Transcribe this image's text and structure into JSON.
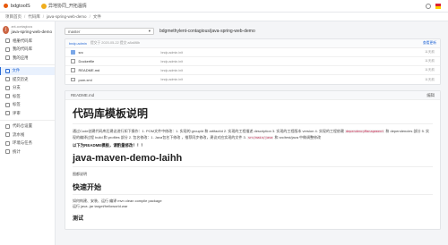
{
  "topbar": {
    "brand": "bdgtoolS",
    "user_switch": "异地协同_开拓温情"
  },
  "breadcrumb": [
    "项目首页",
    "代码库",
    "java-spring-web-demo",
    "文件"
  ],
  "sidebar": {
    "project_group": "ant-contagious",
    "project_name": "java-spring-web-demo",
    "project_initial": "j",
    "items": [
      {
        "label": "相册代码库",
        "active": false
      },
      {
        "label": "我的代码库",
        "active": false
      },
      {
        "label": "我的应用",
        "active": false
      },
      {
        "label": "文件",
        "active": true
      },
      {
        "label": "提交历史",
        "active": false
      },
      {
        "label": "分支",
        "active": false
      },
      {
        "label": "标签",
        "active": false
      },
      {
        "label": "标签",
        "active": false
      },
      {
        "label": "评审",
        "active": false
      },
      {
        "label": "代码仓设置",
        "active": false
      },
      {
        "label": "流水线",
        "active": false
      },
      {
        "label": "环境与任务",
        "active": false
      },
      {
        "label": "统计",
        "active": false
      }
    ]
  },
  "toolbar": {
    "branch": "master",
    "path": "bdgmethylent-contagious/java-spring-web-demo"
  },
  "commit": {
    "author": "bndp.admin",
    "text": "提交于 2020-05-22 提交 a8a6f8b",
    "count": "查看更新"
  },
  "files": [
    {
      "type": "folder",
      "name": "src",
      "msg": "bndp.admin.init",
      "time": "11天前"
    },
    {
      "type": "doc",
      "name": "Dockerfile",
      "msg": "bndp.admin.init",
      "time": "11天前"
    },
    {
      "type": "doc",
      "name": "README.md",
      "msg": "bndp.admin.init",
      "time": "11天前"
    },
    {
      "type": "doc",
      "name": "pom.xml",
      "msg": "bndp.admin.init",
      "time": "11天前"
    }
  ],
  "readme": {
    "file": "README.md",
    "edit": "编辑",
    "title": "代码库模板说明",
    "intro_a": "通过Code创建代码库后建议进行如下操作：1. POM文件中修改：1. 实现的 groupId 和 artifactId 2. 实现的工程描述 description 3. 实现的工程版本 version 4. 实现的工程依赖",
    "intro_code1": "dependencyManagement",
    "intro_b": "和 dependencies 部分 5. 实现的编译过程 build 和 profiles 部分 2. 包名修改：1. Java包名下修改 ，推荐同步修改，建议对应实现的文件 3.",
    "intro_code2": "src/main/java",
    "intro_c": "和 src/test/java 中做调整修改",
    "strong": "以下为README模板，请酌量修改！！！",
    "title2": "java-maven-demo-laihh",
    "desc": "图都说明",
    "h_quick": "快速开始",
    "quick1": "如何构建、安装、运行 编译 mvn clean compile package",
    "quick2": "运行 java -jar target/helloworld.war",
    "h_test": "测试"
  }
}
